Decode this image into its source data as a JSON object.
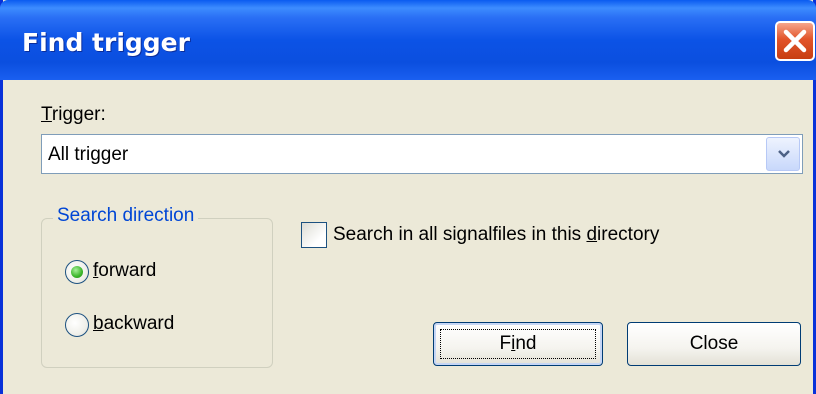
{
  "window": {
    "title": "Find trigger"
  },
  "trigger": {
    "label_first": "T",
    "label_rest": "rigger:",
    "value": "All trigger"
  },
  "search_direction": {
    "legend": "Search direction",
    "options": [
      {
        "mnemonic": "f",
        "rest": "orward",
        "selected": true
      },
      {
        "mnemonic": "b",
        "rest": "ackward",
        "selected": false
      }
    ]
  },
  "search_all": {
    "label_before": "Search in all signalfiles in this ",
    "label_mnemonic": "d",
    "label_after": "irectory",
    "checked": false
  },
  "buttons": {
    "find_before": "F",
    "find_mnemonic": "i",
    "find_after": "nd",
    "close": "Close"
  },
  "colors": {
    "title_bar": "#0c53e6",
    "close_button": "#e2542a",
    "group_legend": "#0046d5",
    "dialog_bg": "#ece9d8"
  }
}
